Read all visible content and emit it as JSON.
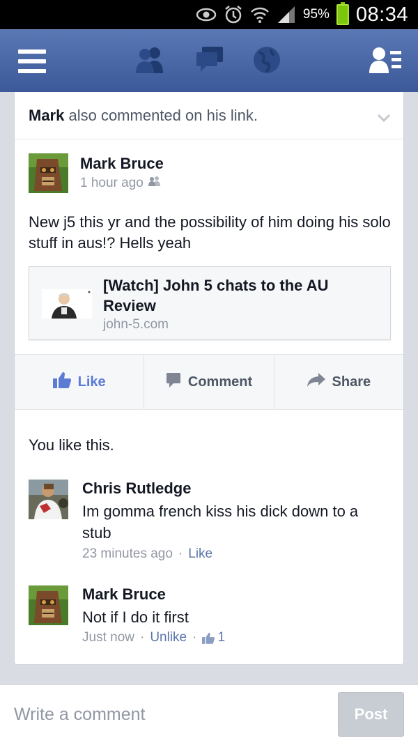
{
  "status_bar": {
    "battery_percent": "95%",
    "time": "08:34",
    "icons": [
      "eye-icon",
      "alarm-icon",
      "wifi-icon",
      "signal-icon",
      "battery-icon"
    ]
  },
  "header": {
    "icons": [
      "menu-icon",
      "friend-requests-icon",
      "messages-icon",
      "notifications-globe-icon",
      "contacts-icon"
    ]
  },
  "story": {
    "header_name": "Mark",
    "header_rest": " also commented on his link.",
    "author": "Mark Bruce",
    "time": "1 hour ago",
    "text": "New j5 this yr and the possibility of him doing his solo stuff in aus!? Hells yeah",
    "link": {
      "title": "[Watch] John 5 chats to the AU Review",
      "domain": "john-5.com"
    },
    "actions": {
      "like": "Like",
      "comment": "Comment",
      "share": "Share"
    },
    "likes_summary": "You like this.",
    "comments": [
      {
        "name": "Chris Rutledge",
        "text": "Im gomma french kiss his dick down to a stub",
        "time": "23 minutes ago",
        "action": "Like"
      },
      {
        "name": "Mark Bruce",
        "text": "Not if I do it first",
        "time": "Just now",
        "action": "Unlike",
        "like_count": "1"
      }
    ]
  },
  "composer": {
    "placeholder": "Write a comment",
    "post_label": "Post"
  },
  "colors": {
    "header_blue": "#3b5998",
    "link_blue": "#5b7bd5",
    "meta_gray": "#9197a3"
  }
}
